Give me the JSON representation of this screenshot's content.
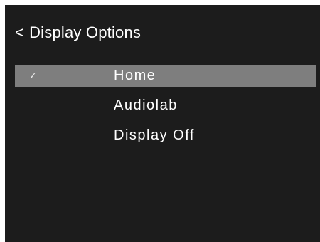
{
  "header": {
    "back_icon": "<",
    "title": "Display Options"
  },
  "menu": {
    "items": [
      {
        "label": "Home",
        "selected": true,
        "check": "✓"
      },
      {
        "label": "Audiolab",
        "selected": false,
        "check": ""
      },
      {
        "label": "Display Off",
        "selected": false,
        "check": ""
      }
    ]
  },
  "colors": {
    "background": "#1c1c1c",
    "highlight": "#7e7e7e",
    "text": "#ffffff"
  }
}
